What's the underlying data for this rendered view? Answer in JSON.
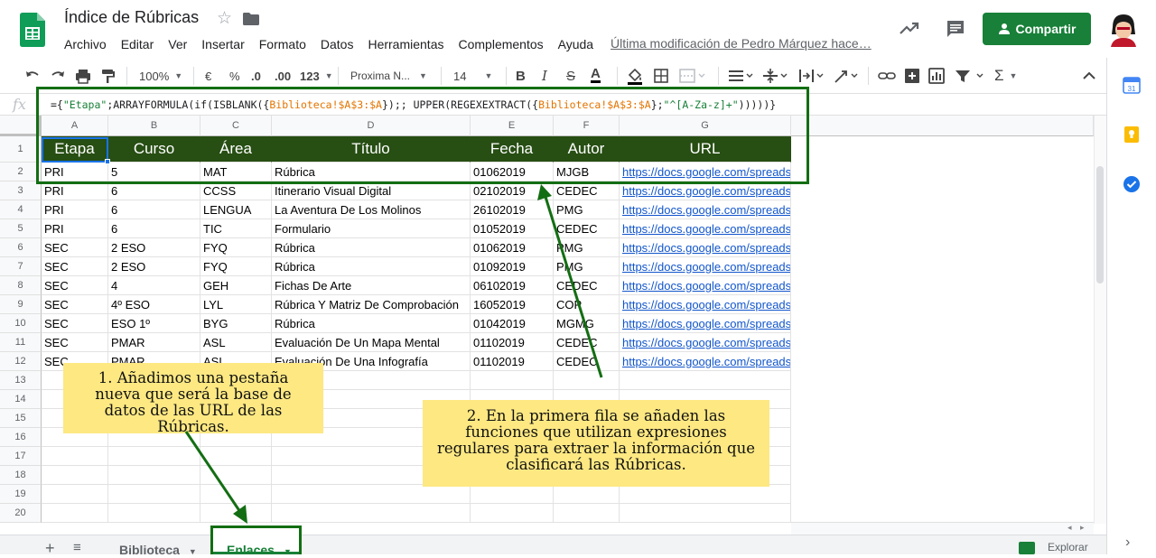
{
  "header": {
    "title": "Índice de Rúbricas",
    "menus": [
      "Archivo",
      "Editar",
      "Ver",
      "Insertar",
      "Formato",
      "Datos",
      "Herramientas",
      "Complementos",
      "Ayuda"
    ],
    "last_edit": "Última modificación de Pedro Márquez hace…",
    "share_label": "Compartir"
  },
  "toolbar": {
    "zoom": "100%",
    "currency": "€",
    "percent": "%",
    "dec_less": ".0",
    "dec_more": ".00",
    "more_formats": "123",
    "font": "Proxima N...",
    "font_size": "14",
    "bold": "B",
    "italic": "I",
    "strike": "S",
    "sigma": "Σ"
  },
  "formula": {
    "fx": "fx",
    "parts": [
      "={",
      "\"Etapa\"",
      ";ARRAYFORMULA(if(ISBLANK({",
      "Biblioteca!$A$3:$A",
      "});; UPPER(REGEXEXTRACT({",
      "Biblioteca!$A$3:$A",
      "};",
      "\"^[A-Za-z]+\"",
      ")))))}"
    ]
  },
  "columns": [
    "A",
    "B",
    "C",
    "D",
    "E",
    "F",
    "G"
  ],
  "row_numbers": [
    "1",
    "2",
    "3",
    "4",
    "5",
    "6",
    "7",
    "8",
    "9",
    "10",
    "11",
    "12",
    "13",
    "14",
    "15",
    "16",
    "17",
    "18",
    "19",
    "20"
  ],
  "table": {
    "headers": [
      "Etapa",
      "Curso",
      "Área",
      "Título",
      "Fecha",
      "Autor",
      "URL"
    ],
    "rows": [
      [
        "PRI",
        "5",
        "MAT",
        "Rúbrica",
        "01062019",
        "MJGB",
        "https://docs.google.com/spreads"
      ],
      [
        "PRI",
        "6",
        "CCSS",
        "Itinerario Visual Digital",
        "02102019",
        "CEDEC",
        "https://docs.google.com/spreads"
      ],
      [
        "PRI",
        "6",
        "LENGUA",
        "La Aventura De Los Molinos",
        "26102019",
        "PMG",
        "https://docs.google.com/spreads"
      ],
      [
        "PRI",
        "6",
        "TIC",
        "Formulario",
        "01052019",
        "CEDEC",
        "https://docs.google.com/spreads"
      ],
      [
        "SEC",
        "2 ESO",
        "FYQ",
        "Rúbrica",
        "01062019",
        "PMG",
        "https://docs.google.com/spreads"
      ],
      [
        "SEC",
        "2 ESO",
        "FYQ",
        "Rúbrica",
        "01092019",
        "PMG",
        "https://docs.google.com/spreads"
      ],
      [
        "SEC",
        "4",
        "GEH",
        "Fichas De Arte",
        "06102019",
        "CEDEC",
        "https://docs.google.com/spreads"
      ],
      [
        "SEC",
        "4º ESO",
        "LYL",
        "Rúbrica Y Matriz De Comprobación",
        "16052019",
        "COP",
        "https://docs.google.com/spreads"
      ],
      [
        "SEC",
        "ESO 1º",
        "BYG",
        "Rúbrica",
        "01042019",
        "MGMG",
        "https://docs.google.com/spreads"
      ],
      [
        "SEC",
        "PMAR",
        "ASL",
        "Evaluación De Un Mapa Mental",
        "01102019",
        "CEDEC",
        "https://docs.google.com/spreads"
      ],
      [
        "SEC",
        "PMAR",
        "ASL",
        "Evaluación De Una Infografía",
        "01102019",
        "CEDEC",
        "https://docs.google.com/spreads"
      ]
    ]
  },
  "notes": {
    "note1": "1. Añadimos una pestaña nueva que será la base de datos de las URL de las Rúbricas.",
    "note2": "2. En la primera fila se añaden las funciones que utilizan expresiones regulares para extraer la información que clasificará las Rúbricas."
  },
  "sheets": {
    "tabs": [
      "Biblioteca",
      "Enlaces"
    ],
    "active": "Enlaces",
    "explore_label": "Explorar"
  },
  "colors": {
    "header_fill": "#274e13",
    "accent": "#188038",
    "link": "#1155cc",
    "note_fill": "#fde882",
    "annotation": "#136e13"
  },
  "icons": [
    "sheets-logo-icon",
    "star-icon",
    "folder-icon",
    "trend-icon",
    "comment-icon",
    "person-icon",
    "undo-icon",
    "redo-icon",
    "print-icon",
    "paint-format-icon",
    "text-color-icon",
    "fill-color-icon",
    "borders-icon",
    "merge-icon",
    "align-icon",
    "valign-icon",
    "wrap-icon",
    "rotate-icon",
    "link-icon",
    "insert-comment-icon",
    "chart-icon",
    "filter-icon",
    "functions-icon",
    "collapse-icon",
    "calendar-icon",
    "keep-icon",
    "tasks-icon",
    "add-sheet-icon",
    "sheet-list-icon",
    "explore-icon"
  ]
}
